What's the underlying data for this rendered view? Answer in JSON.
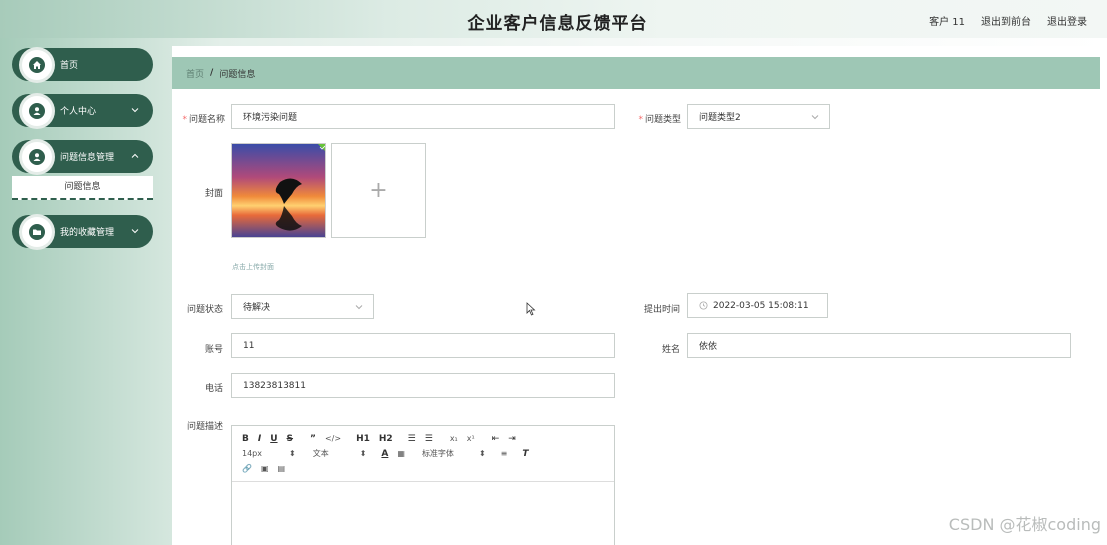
{
  "header": {
    "title": "企业客户信息反馈平台",
    "user": "客户 11",
    "to_front": "退出到前台",
    "logout": "退出登录"
  },
  "sidebar": {
    "items": [
      {
        "label": "首页",
        "icon": "home-icon"
      },
      {
        "label": "个人中心",
        "icon": "user-icon"
      },
      {
        "label": "问题信息管理",
        "icon": "user-icon"
      },
      {
        "label": "我的收藏管理",
        "icon": "folder-icon"
      }
    ],
    "submenu": {
      "label": "问题信息"
    }
  },
  "breadcrumb": {
    "home": "首页",
    "sep": "/",
    "current": "问题信息"
  },
  "form": {
    "question_name": {
      "label": "问题名称",
      "value": "环境污染问题"
    },
    "question_type": {
      "label": "问题类型",
      "value": "问题类型2"
    },
    "cover": {
      "label": "封面",
      "upload_tip": "点击上传封面",
      "plus": "+"
    },
    "status": {
      "label": "问题状态",
      "value": "待解决"
    },
    "submit_time": {
      "label": "提出时间",
      "value": "2022-03-05 15:08:11"
    },
    "account": {
      "label": "账号",
      "value": "11"
    },
    "name": {
      "label": "姓名",
      "value": "依依"
    },
    "phone": {
      "label": "电话",
      "value": "13823813811"
    },
    "description": {
      "label": "问题描述"
    }
  },
  "editor": {
    "font_size": "14px",
    "text_style": "文本",
    "font_family": "标准字体",
    "h1": "H1",
    "h2": "H2"
  },
  "watermark": "CSDN @花椒coding",
  "colors": {
    "accent": "#2f5e4d",
    "breadcrumb": "#9ec7b5",
    "required": "#f56c6c"
  }
}
